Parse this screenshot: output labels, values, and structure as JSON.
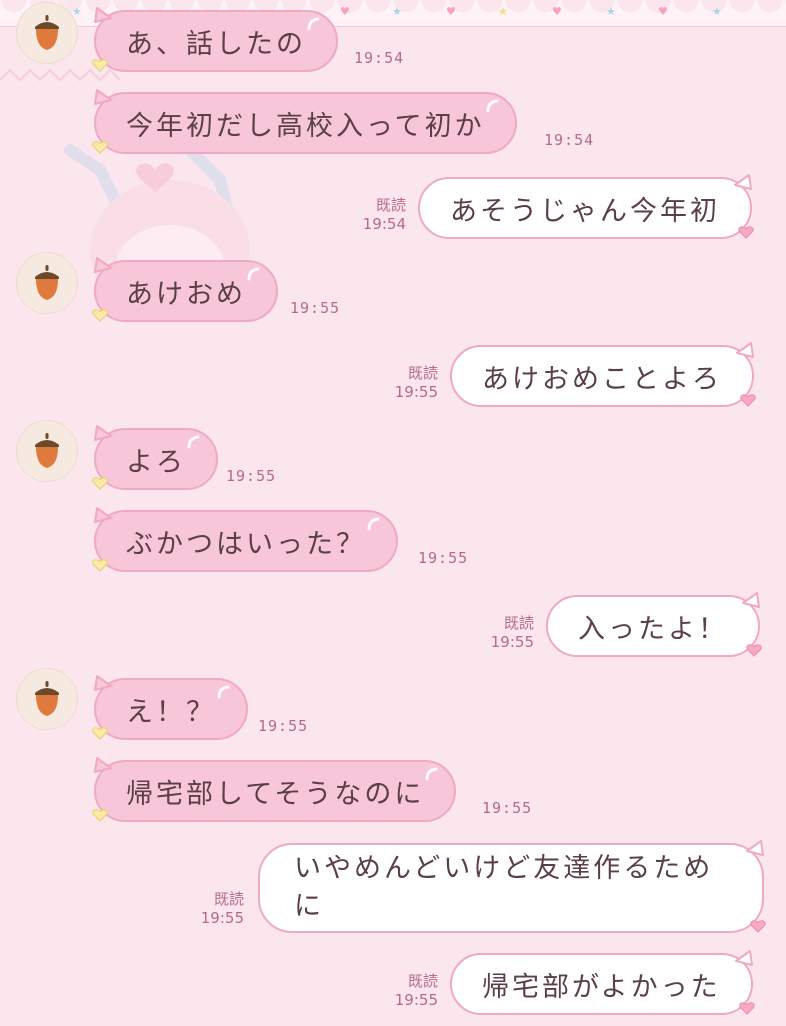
{
  "chat": {
    "messages": [
      {
        "side": "in",
        "text": "あ、話したの",
        "time": "19:54"
      },
      {
        "side": "in",
        "text": "今年初だし高校入って初か",
        "time": "19:54"
      },
      {
        "side": "out",
        "text": "あそうじゃん今年初",
        "time": "19:54",
        "read": "既読"
      },
      {
        "side": "in",
        "text": "あけおめ",
        "time": "19:55"
      },
      {
        "side": "out",
        "text": "あけおめことよろ",
        "time": "19:55",
        "read": "既読"
      },
      {
        "side": "in",
        "text": "よろ",
        "time": "19:55"
      },
      {
        "side": "in",
        "text": "ぶかつはいった？",
        "time": "19:55"
      },
      {
        "side": "out",
        "text": "入ったよ！",
        "time": "19:55",
        "read": "既読"
      },
      {
        "side": "in",
        "text": "え！？",
        "time": "19:55"
      },
      {
        "side": "in",
        "text": "帰宅部してそうなのに",
        "time": "19:55"
      },
      {
        "side": "out",
        "text": "いやめんどいけど友達作るために",
        "time": "19:55",
        "read": "既読"
      },
      {
        "side": "out",
        "text": "帰宅部がよかった",
        "time": "19:55",
        "read": "既読"
      }
    ]
  },
  "contact": {
    "avatar_icon": "acorn-icon"
  },
  "colors": {
    "background": "#fbe6ee",
    "incoming_bubble": "#f7c6d8",
    "outgoing_bubble": "#ffffff",
    "bubble_border": "#f0a9c3",
    "timestamp": "#b56a8a"
  }
}
